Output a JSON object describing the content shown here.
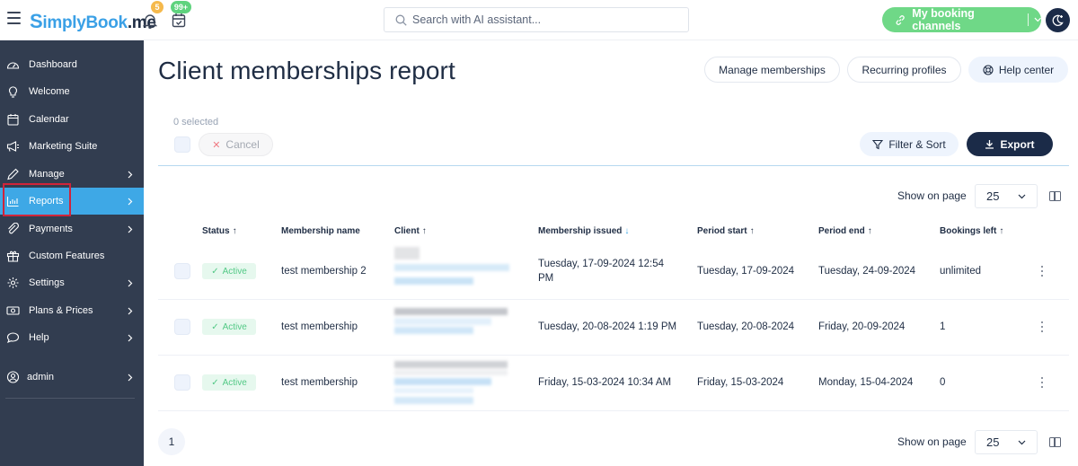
{
  "header": {
    "logo_s": "S",
    "logo_rest": "implyBook",
    "logo_suffix": ".me",
    "notifications_count": "5",
    "bookings_count": "99+",
    "search_placeholder": "Search with AI assistant...",
    "channels_label": "My booking channels",
    "colors": {
      "brand": "#3aa0e6",
      "channels": "#6fd887",
      "dark": "#1b2b48"
    }
  },
  "sidebar": {
    "items": [
      {
        "label": "Dashboard",
        "icon": "dashboard-icon",
        "has_submenu": false
      },
      {
        "label": "Welcome",
        "icon": "lightbulb-icon",
        "has_submenu": false
      },
      {
        "label": "Calendar",
        "icon": "calendar-icon",
        "has_submenu": false
      },
      {
        "label": "Marketing Suite",
        "icon": "megaphone-icon",
        "has_submenu": false
      },
      {
        "label": "Manage",
        "icon": "pencil-icon",
        "has_submenu": true
      },
      {
        "label": "Reports",
        "icon": "bar-chart-icon",
        "has_submenu": true,
        "active": true
      },
      {
        "label": "Payments",
        "icon": "paperclip-icon",
        "has_submenu": true
      },
      {
        "label": "Custom Features",
        "icon": "gift-icon",
        "has_submenu": false
      },
      {
        "label": "Settings",
        "icon": "gear-icon",
        "has_submenu": true
      },
      {
        "label": "Plans & Prices",
        "icon": "banknote-icon",
        "has_submenu": true
      },
      {
        "label": "Help",
        "icon": "chat-bubble-icon",
        "has_submenu": true
      }
    ],
    "user": {
      "label": "admin",
      "icon": "user-circle-icon"
    }
  },
  "main": {
    "title": "Client memberships report",
    "actions": {
      "manage_memberships": "Manage memberships",
      "recurring_profiles": "Recurring profiles",
      "help_center": "Help center"
    },
    "selection": {
      "text": "0 selected",
      "cancel_label": "Cancel"
    },
    "filter_label": "Filter & Sort",
    "export_label": "Export",
    "show_on_page_label": "Show on page",
    "page_size": "25",
    "table": {
      "columns": [
        {
          "label": "Status",
          "sort": "↑"
        },
        {
          "label": "Membership name",
          "sort": ""
        },
        {
          "label": "Client",
          "sort": "↑"
        },
        {
          "label": "Membership issued",
          "sort": "↓"
        },
        {
          "label": "Period start",
          "sort": "↑"
        },
        {
          "label": "Period end",
          "sort": "↑"
        },
        {
          "label": "Bookings left",
          "sort": "↑"
        }
      ],
      "rows": [
        {
          "status": "Active",
          "name": "test membership 2",
          "issued": "Tuesday, 17-09-2024 12:54 PM",
          "start": "Tuesday, 17-09-2024",
          "end": "Tuesday, 24-09-2024",
          "bookings_left": "unlimited"
        },
        {
          "status": "Active",
          "name": "test membership",
          "issued": "Tuesday, 20-08-2024 1:19 PM",
          "start": "Tuesday, 20-08-2024",
          "end": "Friday, 20-09-2024",
          "bookings_left": "1"
        },
        {
          "status": "Active",
          "name": "test membership",
          "issued": "Friday, 15-03-2024 10:34 AM",
          "start": "Friday, 15-03-2024",
          "end": "Monday, 15-04-2024",
          "bookings_left": "0"
        }
      ]
    },
    "pagination": {
      "current_page": "1"
    }
  }
}
